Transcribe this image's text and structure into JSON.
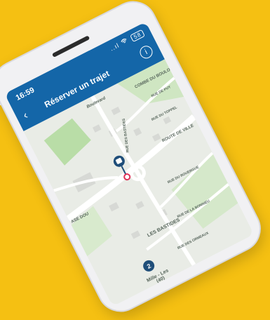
{
  "status": {
    "time": "16:59",
    "signal": "..ıl",
    "wifi": "wifi-icon",
    "battery": "58"
  },
  "header": {
    "title": "Réserver un trajet",
    "back_icon": "chevron-left-icon",
    "info_icon": "info-icon"
  },
  "map": {
    "labels": {
      "combe_du_boulou": "COMBE DU BOULOU",
      "rue_des_bastides": "RUE DES BASTIDES",
      "rue_du_torpel": "RUE DU TOPPEL",
      "route_de_ville": "ROUTE DE VILLE",
      "rue_du_rouergue": "RUE DU ROUERGUE",
      "les_bastides": "LES BASTIDES",
      "rue_de_la_bonnieu": "RUE DE LA BONNIEU",
      "rue_des_ormeaux": "RUE DES ORMEAUX",
      "boulevard": "Boulevard",
      "rue_de_puy": "RUE DE PUY",
      "ase_dou": "ASE DOU",
      "stop_name": "Mille - Les",
      "stop_code": "(40)"
    },
    "marker_count": "2",
    "colors": {
      "header": "#1466A8",
      "road": "#FFFFFF",
      "park": "#B9DDA7",
      "marker": "#1F4E79",
      "pin": "#E0345A"
    }
  }
}
